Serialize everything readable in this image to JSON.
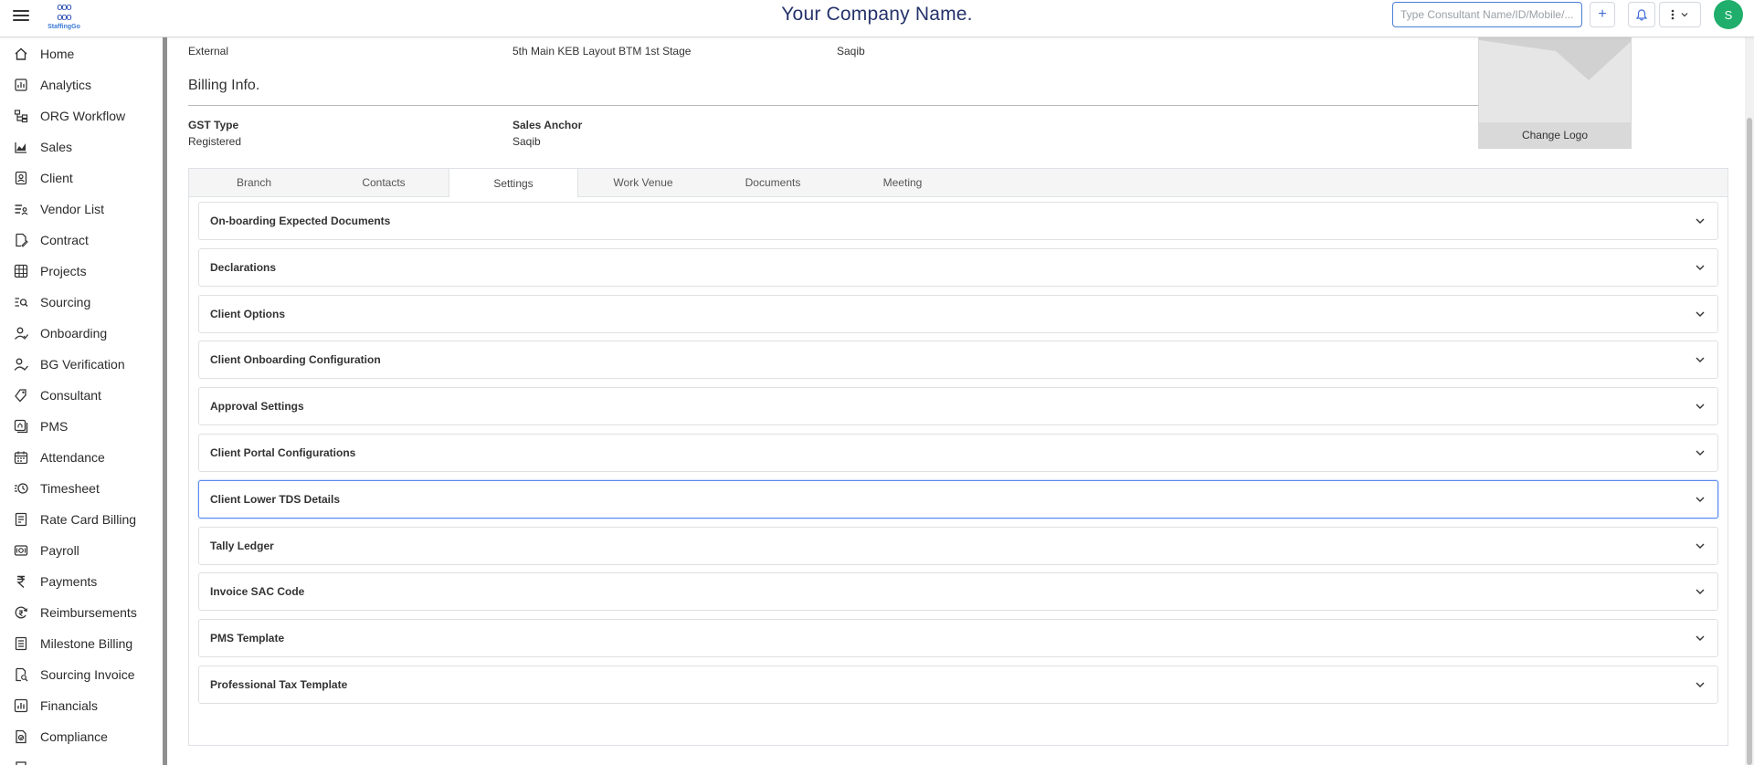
{
  "header": {
    "company_title": "Your Company Name.",
    "logo_text": "StaffingGo",
    "search_placeholder": "Type Consultant Name/ID/Mobile/...",
    "avatar_initial": "S",
    "accent_color": "#3f6ad8",
    "avatar_color": "#1fae6b"
  },
  "sidebar": {
    "items": [
      {
        "label": "Home",
        "icon": "home-icon"
      },
      {
        "label": "Analytics",
        "icon": "analytics-icon"
      },
      {
        "label": "ORG Workflow",
        "icon": "workflow-icon"
      },
      {
        "label": "Sales",
        "icon": "sales-icon"
      },
      {
        "label": "Client",
        "icon": "client-icon"
      },
      {
        "label": "Vendor List",
        "icon": "vendor-list-icon"
      },
      {
        "label": "Contract",
        "icon": "contract-icon"
      },
      {
        "label": "Projects",
        "icon": "projects-icon"
      },
      {
        "label": "Sourcing",
        "icon": "sourcing-icon"
      },
      {
        "label": "Onboarding",
        "icon": "onboarding-icon"
      },
      {
        "label": "BG Verification",
        "icon": "bg-verification-icon"
      },
      {
        "label": "Consultant",
        "icon": "consultant-icon"
      },
      {
        "label": "PMS",
        "icon": "pms-icon"
      },
      {
        "label": "Attendance",
        "icon": "attendance-icon"
      },
      {
        "label": "Timesheet",
        "icon": "timesheet-icon"
      },
      {
        "label": "Rate Card Billing",
        "icon": "rate-card-icon"
      },
      {
        "label": "Payroll",
        "icon": "payroll-icon"
      },
      {
        "label": "Payments",
        "icon": "rupee-icon"
      },
      {
        "label": "Reimbursements",
        "icon": "reimbursements-icon"
      },
      {
        "label": "Milestone Billing",
        "icon": "milestone-icon"
      },
      {
        "label": "Sourcing Invoice",
        "icon": "invoice-search-icon"
      },
      {
        "label": "Financials",
        "icon": "financials-icon"
      },
      {
        "label": "Compliance",
        "icon": "compliance-icon"
      }
    ]
  },
  "client_info": {
    "type_value": "External",
    "address_value": "5th Main KEB Layout BTM 1st Stage",
    "engagement_value": "Saqib"
  },
  "billing": {
    "title": "Billing Info.",
    "gst_type_label": "GST Type",
    "gst_type_value": "Registered",
    "sales_anchor_label": "Sales Anchor",
    "sales_anchor_value": "Saqib",
    "change_logo_label": "Change Logo"
  },
  "tabs": [
    {
      "label": "Branch",
      "active": false
    },
    {
      "label": "Contacts",
      "active": false
    },
    {
      "label": "Settings",
      "active": true
    },
    {
      "label": "Work Venue",
      "active": false
    },
    {
      "label": "Documents",
      "active": false
    },
    {
      "label": "Meeting",
      "active": false
    }
  ],
  "accordions": [
    {
      "title": "On-boarding Expected Documents",
      "focused": false
    },
    {
      "title": "Declarations",
      "focused": false
    },
    {
      "title": "Client Options",
      "focused": false
    },
    {
      "title": "Client Onboarding Configuration",
      "focused": false
    },
    {
      "title": "Approval Settings",
      "focused": false
    },
    {
      "title": "Client Portal Configurations",
      "focused": false
    },
    {
      "title": "Client Lower TDS Details",
      "focused": true
    },
    {
      "title": "Tally Ledger",
      "focused": false
    },
    {
      "title": "Invoice SAC Code",
      "focused": false
    },
    {
      "title": "PMS Template",
      "focused": false
    },
    {
      "title": "Professional Tax Template",
      "focused": false
    }
  ]
}
